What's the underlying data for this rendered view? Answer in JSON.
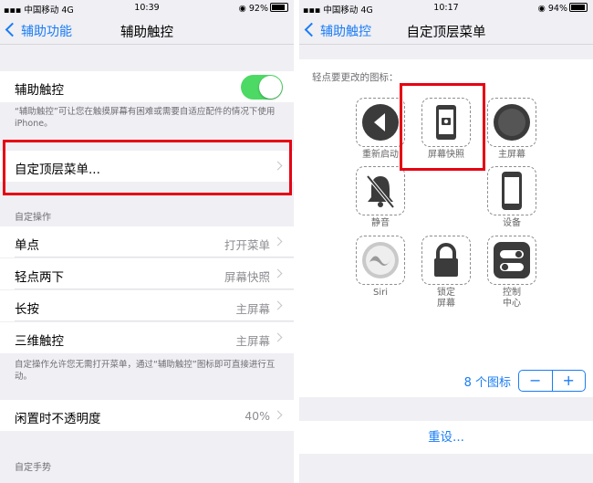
{
  "left": {
    "status": {
      "carrier": "中国移动",
      "network": "4G",
      "time": "10:39",
      "battery": "92%"
    },
    "nav": {
      "back_label": "辅助功能",
      "title": "辅助触控"
    },
    "toggle_row": {
      "label": "辅助触控",
      "on": true
    },
    "toggle_footer": "“辅助触控”可让您在触摸屏幕有困难或需要自适应配件的情况下使用 iPhone。",
    "top_menu_row": {
      "label": "自定顶层菜单..."
    },
    "actions_header": "自定操作",
    "actions": [
      {
        "label": "单点",
        "value": "打开菜单"
      },
      {
        "label": "轻点两下",
        "value": "屏幕快照"
      },
      {
        "label": "长按",
        "value": "主屏幕"
      },
      {
        "label": "三维触控",
        "value": "主屏幕"
      }
    ],
    "actions_footer": "自定操作允许您无需打开菜单，通过“辅助触控”图标即可直接进行互动。",
    "opacity_row": {
      "label": "闲置时不透明度",
      "value": "40%"
    },
    "gestures_header": "自定手势"
  },
  "right": {
    "status": {
      "carrier": "中国移动",
      "network": "4G",
      "time": "10:17",
      "battery": "94%"
    },
    "nav": {
      "back_label": "辅助触控",
      "title": "自定顶层菜单"
    },
    "hint": "轻点要更改的图标：",
    "icons": [
      {
        "name": "restart",
        "label": "重新启动",
        "icon": "back-arrow-icon"
      },
      {
        "name": "screenshot",
        "label": "屏幕快照",
        "icon": "phone-camera-icon"
      },
      {
        "name": "home",
        "label": "主屏幕",
        "icon": "home-button-icon"
      },
      {
        "name": "mute",
        "label": "静音",
        "icon": "muted-bell-icon"
      },
      {
        "name": "device",
        "label": "设备",
        "icon": "iphone-icon"
      },
      {
        "name": "siri",
        "label": "Siri",
        "icon": "siri-icon"
      },
      {
        "name": "lock",
        "label": "锁定\n屏幕",
        "icon": "lock-icon"
      },
      {
        "name": "control",
        "label": "控制\n中心",
        "icon": "toggles-icon"
      }
    ],
    "count_label": "8 个图标",
    "stepper": {
      "minus": "−",
      "plus": "+"
    },
    "reset_label": "重设..."
  },
  "colors": {
    "accent": "#1a7cf5",
    "toggle_on": "#4cd964",
    "highlight": "#e60012"
  }
}
